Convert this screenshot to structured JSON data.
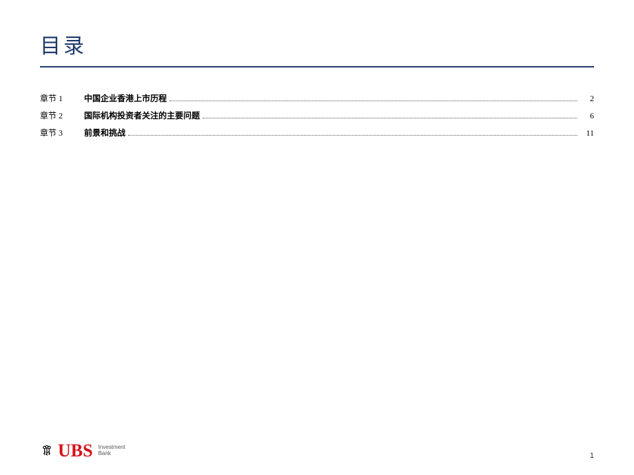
{
  "title": "目录",
  "toc": {
    "items": [
      {
        "chapter": "章节 1",
        "entry": "中国企业香港上市历程",
        "page": "2"
      },
      {
        "chapter": "章节 2",
        "entry": "国际机构投资者关注的主要问题",
        "page": "6"
      },
      {
        "chapter": "章节 3",
        "entry": "前景和挑战",
        "page": "11"
      }
    ]
  },
  "footer": {
    "logo_name": "UBS",
    "logo_sub1": "Investment",
    "logo_sub2": "Bank",
    "page_number": "1"
  }
}
